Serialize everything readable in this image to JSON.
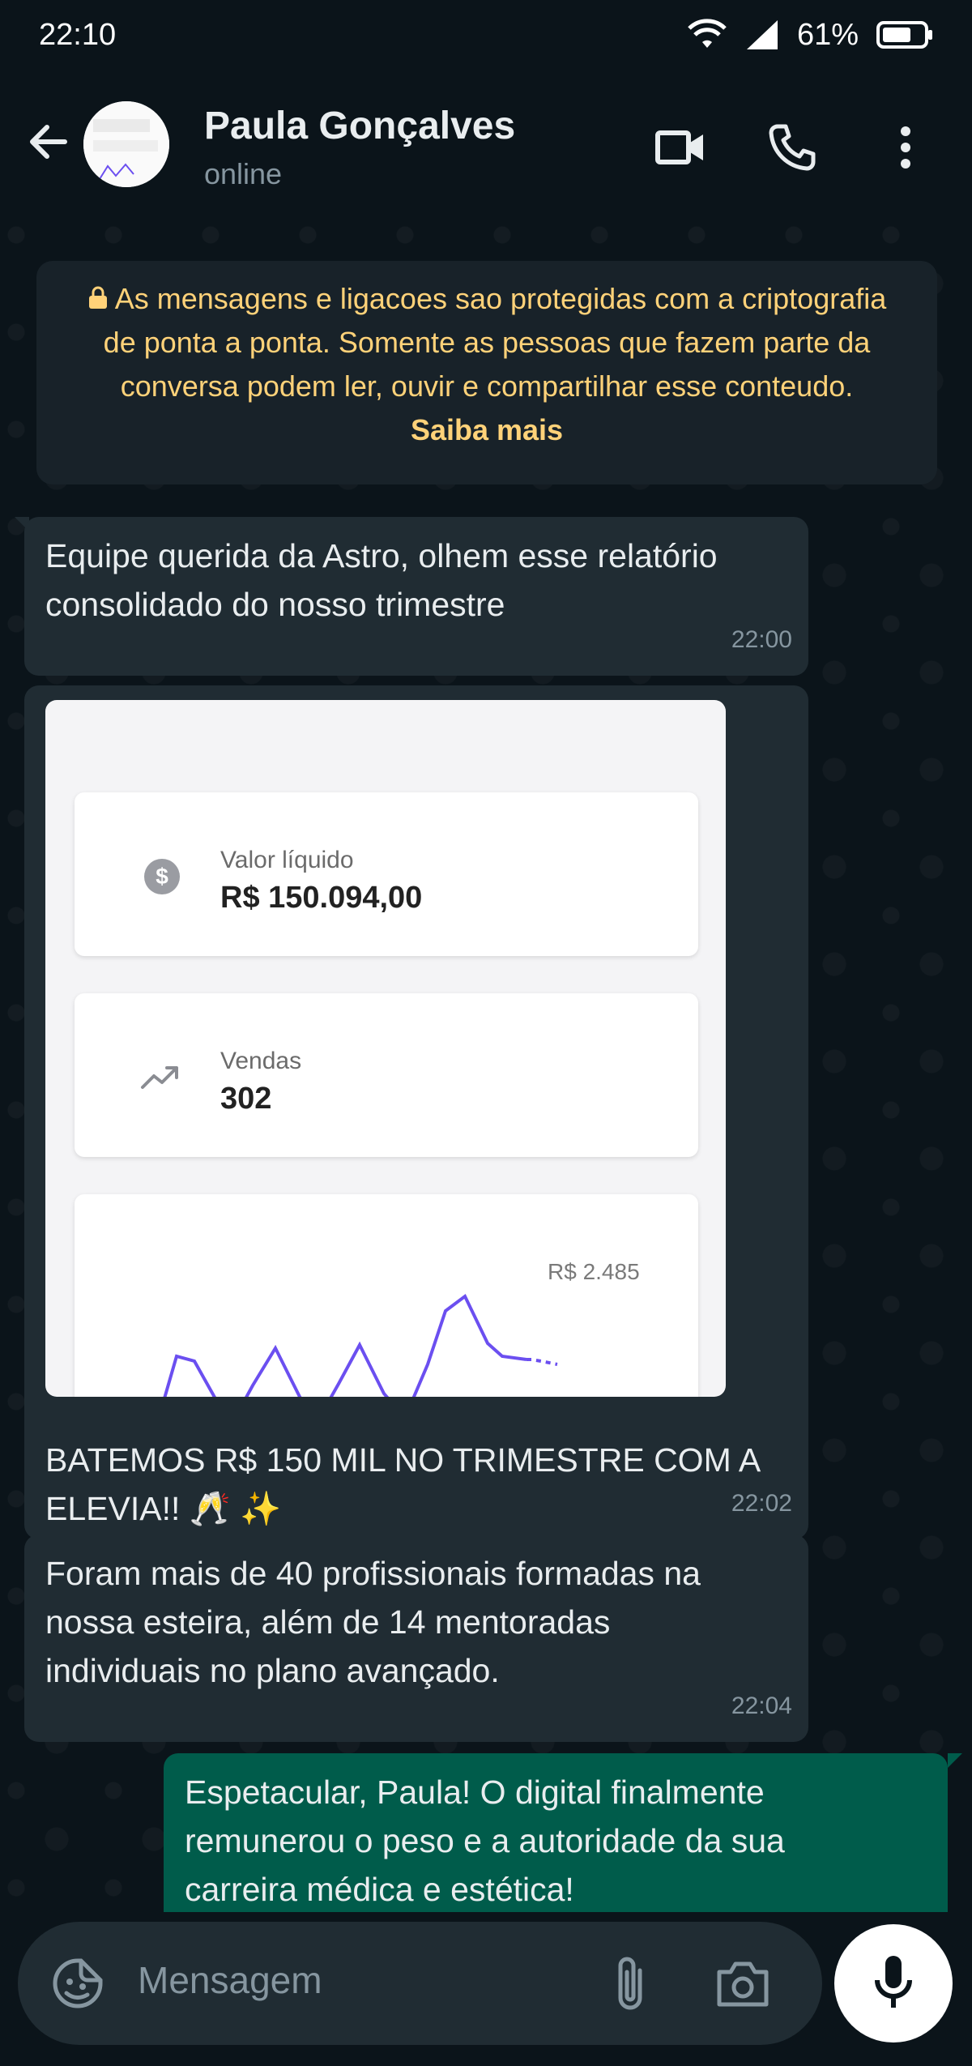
{
  "status_bar": {
    "time": "22:10",
    "battery": "61%"
  },
  "header": {
    "name": "Paula Gonçalves",
    "status": "online"
  },
  "encryption": {
    "text": "As mensagens e ligacoes sao protegidas com a criptografia de ponta a ponta. Somente as pessoas que fazem parte da conversa podem ler, ouvir e compartilhar esse conteudo.",
    "link": "Saiba mais"
  },
  "messages": [
    {
      "text": "Equipe querida da Astro, olhem esse relatório\nconsolidado do nosso trimestre",
      "time": "22:00"
    },
    {
      "caption": "BATEMOS R$ 150 MIL NO TRIMESTRE COM A\nELEVIA!! 🥂 ✨",
      "time": "22:02",
      "image": {
        "card1_label": "Valor líquido",
        "card1_value": "R$ 150.094,00",
        "card2_label": "Vendas",
        "card2_value": "302",
        "chart_peak_label": "R$ 2.485"
      }
    },
    {
      "text": "Foram mais de 40 profissionais formadas na\nnossa esteira, além de 14 mentoradas\nindividuais no plano avançado.",
      "time": "22:04"
    },
    {
      "text": "Espetacular, Paula! O digital finalmente\nremunerou o peso e a autoridade da sua\ncarreira médica e estética!"
    }
  ],
  "input": {
    "placeholder": "Mensagem"
  },
  "colors": {
    "bg": "#0b141a",
    "incoming": "#202c33",
    "outgoing": "#005c4b",
    "notice_text": "#ffd279",
    "accent_chart": "#6b4ff0"
  }
}
